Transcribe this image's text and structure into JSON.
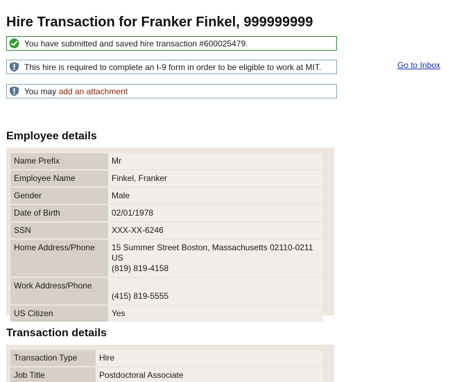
{
  "page": {
    "title": "Hire Transaction for Franker Finkel, 999999999"
  },
  "messages": {
    "success": "You have submitted and saved hire transaction #600025479.",
    "i9_notice": "This hire is required to complete an I-9 form in order to be eligible to work at MIT.",
    "attachment_prefix": "You may ",
    "attachment_link": "add an attachment"
  },
  "nav": {
    "goto_inbox": "Go to Inbox"
  },
  "employee_details": {
    "heading": "Employee details",
    "rows": [
      {
        "label": "Name Prefix",
        "value": "Mr"
      },
      {
        "label": "Employee Name",
        "value": "Finkel, Franker"
      },
      {
        "label": "Gender",
        "value": "Male"
      },
      {
        "label": "Date of Birth",
        "value": "02/01/1978"
      },
      {
        "label": "SSN",
        "value": "XXX-XX-6246"
      },
      {
        "label": "Home Address/Phone",
        "lines": [
          "15 Summer Street Boston, Massachusetts 02110-0211",
          "US",
          "(819) 819-4158"
        ]
      },
      {
        "label": "Work Address/Phone",
        "lines": [
          "",
          "(415) 819-5555"
        ]
      },
      {
        "label": "US Citizen",
        "value": "Yes"
      }
    ]
  },
  "transaction_details": {
    "heading": "Transaction details",
    "rows": [
      {
        "label": "Transaction Type",
        "value": "Hire"
      },
      {
        "label": "Job Title",
        "value": "Postdoctoral Associate"
      }
    ]
  },
  "colors": {
    "success_border": "#2e8b2e",
    "info_border": "#8aa4b8",
    "link": "#1a2faa",
    "attachment_link": "#8b2500",
    "label_bg": "#d8d0c8",
    "value_bg": "#f1eeea",
    "panel_bg": "#ece6df"
  }
}
